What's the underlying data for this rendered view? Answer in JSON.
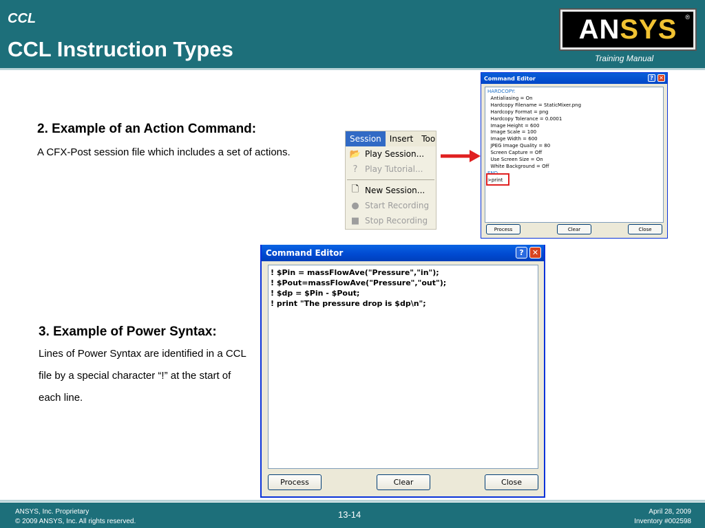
{
  "header": {
    "section": "CCL",
    "title": "CCL Instruction Types",
    "logo_text_a": "AN",
    "logo_text_b": "SYS",
    "logo_reg": "®",
    "training": "Training Manual"
  },
  "section2": {
    "heading": "2. Example of an Action Command:",
    "text": "A CFX-Post session file which includes a set of actions."
  },
  "section3": {
    "heading": "3. Example of Power Syntax:",
    "text": "Lines of Power Syntax are identified in a CCL file by a special character “!” at the start of each line."
  },
  "menu": {
    "bar": [
      "Session",
      "Insert",
      "Tool"
    ],
    "items": [
      {
        "label": "Play Session...",
        "icon": "folder-play-icon",
        "glyph": "📂",
        "disabled": false
      },
      {
        "label": "Play Tutorial...",
        "icon": "tutorial-icon",
        "glyph": "?",
        "disabled": true
      },
      {
        "label": "New Session...",
        "icon": "new-session-icon",
        "glyph": "🗋",
        "disabled": false
      },
      {
        "label": "Start Recording",
        "icon": "record-icon",
        "glyph": "●",
        "disabled": true
      },
      {
        "label": "Stop Recording",
        "icon": "stop-record-icon",
        "glyph": "■",
        "disabled": true
      }
    ]
  },
  "small_editor": {
    "title": "Command Editor",
    "block_header": "HARDCOPY:",
    "lines": [
      "  Antialiasing = On",
      "  Hardcopy Filename = StaticMixer.png",
      "  Hardcopy Format = png",
      "  Hardcopy Tolerance = 0.0001",
      "  Image Height = 600",
      "  Image Scale = 100",
      "  Image Width = 600",
      "  JPEG Image Quality = 80",
      "  Screen Capture = Off",
      "  Use Screen Size = On",
      "  White Background = Off"
    ],
    "block_end": "END",
    "action": ">print",
    "buttons": {
      "process": "Process",
      "clear": "Clear",
      "close": "Close"
    }
  },
  "big_editor": {
    "title": "Command Editor",
    "lines": [
      "! $Pin = massFlowAve(\"Pressure\",\"in\");",
      "! $Pout=massFlowAve(\"Pressure\",\"out\");",
      "! $dp = $Pin - $Pout;",
      "! print \"The pressure drop is $dp\\n\";"
    ],
    "buttons": {
      "process": "Process",
      "clear": "Clear",
      "close": "Close"
    }
  },
  "footer": {
    "left1": "ANSYS, Inc. Proprietary",
    "left2": "© 2009 ANSYS, Inc.  All rights reserved.",
    "page": "13-14",
    "right1": "April 28, 2009",
    "right2": "Inventory #002598"
  },
  "colors": {
    "header_bg": "#1d6f7a",
    "accent_red": "#e02020",
    "xp_title_blue": "#0049d0"
  }
}
